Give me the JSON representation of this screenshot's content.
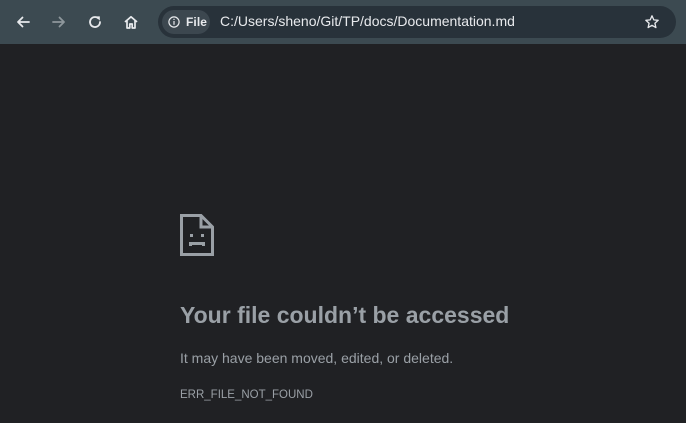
{
  "toolbar": {
    "back_icon": "arrow-left-icon",
    "forward_icon": "arrow-right-icon",
    "reload_icon": "reload-icon",
    "home_icon": "home-icon",
    "colors": {
      "toolbar_bg": "#3c4a51",
      "omnibox_bg": "#28323a",
      "chip_bg": "#3c474f",
      "icon": "#e8eaed",
      "icon_disabled": "#8e979c"
    }
  },
  "omnibox": {
    "chip_icon": "info-icon",
    "chip_label": "File",
    "url": "C:/Users/sheno/Git/TP/docs/Documentation.md",
    "bookmark_icon": "star-outline-icon"
  },
  "error_page": {
    "icon": "sad-file-icon",
    "title": "Your file couldn’t be accessed",
    "description": "It may have been moved, edited, or deleted.",
    "code": "ERR_FILE_NOT_FOUND",
    "colors": {
      "background": "#202124",
      "text": "#9aa0a6"
    }
  }
}
